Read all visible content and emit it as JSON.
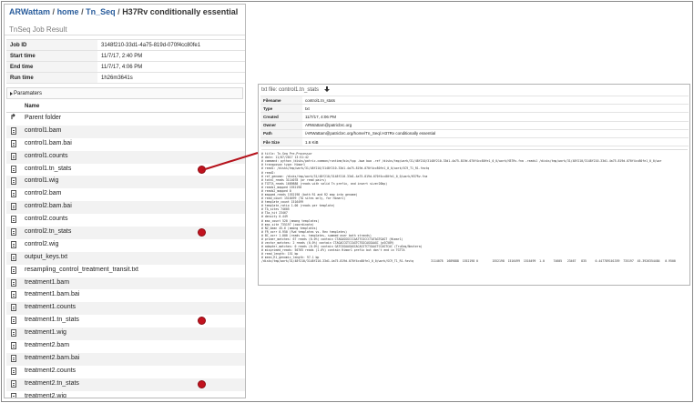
{
  "breadcrumb": {
    "items": [
      "ARWattam",
      "home",
      "Tn_Seq"
    ],
    "current": "H37Rv conditionally essential",
    "separator": "/"
  },
  "job_result": {
    "title": "TnSeq Job Result",
    "fields": [
      {
        "label": "Job ID",
        "value": "3148f210-33d1-4a75-819d-070f4cc80fe1"
      },
      {
        "label": "Start time",
        "value": "11/7/17, 2:40 PM"
      },
      {
        "label": "End time",
        "value": "11/7/17, 4:06 PM"
      },
      {
        "label": "Run time",
        "value": "1h26m3641s"
      }
    ],
    "parameters_label": "Paramaters"
  },
  "file_list": {
    "header": "Name",
    "parent": "Parent folder",
    "files": [
      {
        "name": "control1.bam",
        "marked": false
      },
      {
        "name": "control1.bam.bai",
        "marked": false
      },
      {
        "name": "control1.counts",
        "marked": false
      },
      {
        "name": "control1.tn_stats",
        "marked": true
      },
      {
        "name": "control1.wig",
        "marked": false
      },
      {
        "name": "control2.bam",
        "marked": false
      },
      {
        "name": "control2.bam.bai",
        "marked": false
      },
      {
        "name": "control2.counts",
        "marked": false
      },
      {
        "name": "control2.tn_stats",
        "marked": true
      },
      {
        "name": "control2.wig",
        "marked": false
      },
      {
        "name": "output_keys.txt",
        "marked": false
      },
      {
        "name": "resampling_control_treatment_transit.txt",
        "marked": false
      },
      {
        "name": "treatment1.bam",
        "marked": false
      },
      {
        "name": "treatment1.bam.bai",
        "marked": false
      },
      {
        "name": "treatment1.counts",
        "marked": false
      },
      {
        "name": "treatment1.tn_stats",
        "marked": true
      },
      {
        "name": "treatment1.wig",
        "marked": false
      },
      {
        "name": "treatment2.bam",
        "marked": false
      },
      {
        "name": "treatment2.bam.bai",
        "marked": false
      },
      {
        "name": "treatment2.counts",
        "marked": false
      },
      {
        "name": "treatment2.tn_stats",
        "marked": true
      },
      {
        "name": "treatment2.wig",
        "marked": false
      }
    ]
  },
  "file_viewer": {
    "title": "txt file: control1.tn_stats",
    "icon": "download-icon",
    "fields": [
      {
        "label": "Filename",
        "value": "control1.tn_stats"
      },
      {
        "label": "Type",
        "value": "txt"
      },
      {
        "label": "Created",
        "value": "11/7/17, 4:06 PM"
      },
      {
        "label": "Owner",
        "value": "ARWattam@patricbrc.org"
      },
      {
        "label": "Path",
        "value": "/ARWattam@patricbrc.org/home/Tn_Seq/.H37Rv conditionally essential"
      },
      {
        "label": "File Size",
        "value": "1.6 KiB"
      }
    ],
    "preview_lines": [
      "# title: Tn-Seq Pre-Processor",
      "# date: 11/07/2017 13:51:42",
      "# command: python /disks/patric-common/runtime/bin/tpp -bwa bwa -ref /disks/tmp/work/31/48f210/3148f210-33d1-4a75-819d-070f4cc80fe1_0_0/work/H37Rv.fna -reads1 /disks/tmp/work/31/48f210/3148f210-33d1-4a75-819d-070f4cc80fe1_0_0/wor",
      "# transposon type: Himar1",
      "# read1: /disks/tmp/work/31/48f210/3148f210-33d1-4a75-819d-070f4cc80fe1_0_0/work/SC9_T1_R1.fastq",
      "# read2:",
      "# ref_genome: /disks/tmp/work/31/48f210/3148f210-33d1-4a75-819d-070f4cc80fe1_0_0/work/H37Rv.fna",
      "# total_reads 3114078 (or read pairs)",
      "# TGTTA_reads 1689888 (reads with valid Tn prefix, and insert size>20bp)",
      "# reads1_mapped 1552198",
      "# reads2_mapped 0",
      "# mapped_reads 1552198 (both R1 and R2 map into genome)",
      "# read_count 1516499 (TA sites only, for Himar1)",
      "# template_count 1516499",
      "# template_ratio 1.00 (reads per template)",
      "# TA_sites 74605",
      "# TAs_hit 23467",
      "# density 0.449",
      "# max_count 520 (among templates)",
      "# max_site 735197 (coordinate)",
      "# NZ_mean 45.6 (among templates)",
      "# FR_corr 0.950 (Fwd templates vs. Rev templates)",
      "# BC_corr 1.000 (reads vs. templates, summed over both strands)",
      "# primer_matches: 67 reads (0.0%) contain CTAGAGGGCCCAATTCGCCCTATAGTGAGT (Himar1)",
      "# vector_matches: 2 reads (0.0%) contain CTAGACCGTCCAGTCTGGCAGGAAGC (pSC589)",
      "# adapter_matches: 0 reads (0.0%) contain GATCGGAAGAGCACACGTCTGAACTCCAGTCAC (TruSeq/Nextera)",
      "# misprimed_reads: 50765 reads (1.6%) contain Himar1 prefix but don't end in TGTTA",
      "# read_length: 151 bp",
      "# mean_R1_genomic_length: 97.1 bp",
      "/disks/tmp/work/31/48f210/3148f210-33d1-4a75-819d-070f4cc80fe1_0_0/work/SC9_T1_R1.fastq          3114078  1689888  1552198 0        1552198  1516499  1516499  1.0     74605   23467   835     0.447789101359  735197  45.3926354484   0.9500"
    ]
  },
  "annotation": {
    "marker_color": "#c2121e",
    "connector_color": "#b5121b"
  }
}
